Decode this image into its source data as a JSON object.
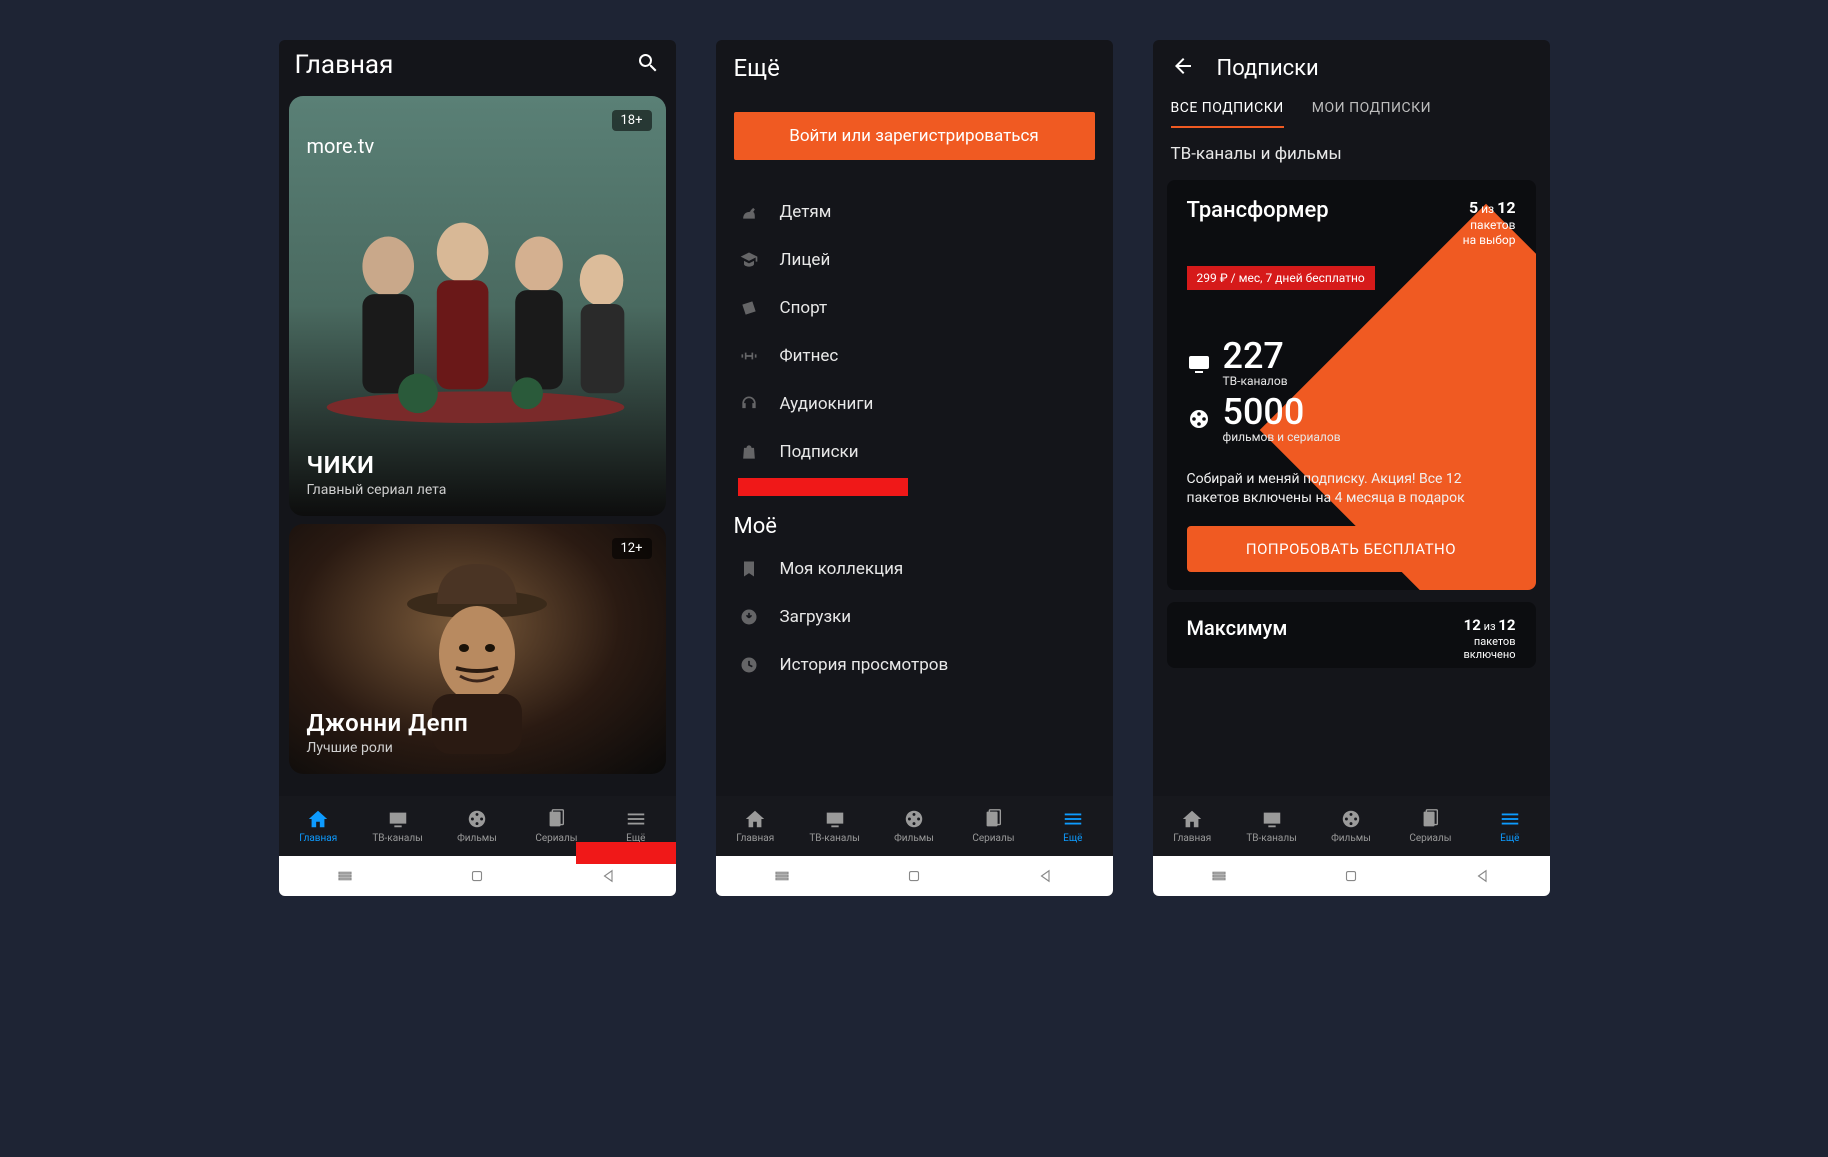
{
  "colors": {
    "accent": "#f05a22",
    "brand_blue": "#0d9bff",
    "danger": "#d61a1a"
  },
  "nav": [
    {
      "label": "Главная"
    },
    {
      "label": "ТВ-каналы"
    },
    {
      "label": "Фильмы"
    },
    {
      "label": "Сериалы"
    },
    {
      "label": "Ещё"
    }
  ],
  "screen1": {
    "title": "Главная",
    "card1": {
      "brand": "more.tv",
      "age": "18+",
      "title": "ЧИКИ",
      "subtitle": "Главный сериал лета"
    },
    "card2": {
      "age": "12+",
      "title": "Джонни Депп",
      "subtitle": "Лучшие роли"
    }
  },
  "screen2": {
    "title": "Ещё",
    "login": "Войти или зарегистрироваться",
    "menu": [
      {
        "label": "Детям"
      },
      {
        "label": "Лицей"
      },
      {
        "label": "Спорт"
      },
      {
        "label": "Фитнес"
      },
      {
        "label": "Аудиокниги"
      },
      {
        "label": "Подписки"
      }
    ],
    "mine_title": "Моё",
    "mine": [
      {
        "label": "Моя коллекция"
      },
      {
        "label": "Загрузки"
      },
      {
        "label": "История просмотров"
      }
    ]
  },
  "screen3": {
    "title": "Подписки",
    "tabs": [
      "ВСЕ ПОДПИСКИ",
      "МОИ ПОДПИСКИ"
    ],
    "section": "ТВ-каналы и фильмы",
    "plan1": {
      "name": "Трансформер",
      "count_a": "5",
      "count_sep": "из",
      "count_b": "12",
      "right_line1": "пакетов",
      "right_line2": "на выбор",
      "price": "299 ₽ / мес, 7 дней бесплатно",
      "stat1_num": "227",
      "stat1_label": "ТВ-каналов",
      "stat2_num": "5000",
      "stat2_label": "фильмов и сериалов",
      "desc": "Собирай и меняй подписку. Акция! Все 12 пакетов включены на 4 месяца в подарок",
      "cta": "ПОПРОБОВАТЬ БЕСПЛАТНО"
    },
    "plan2": {
      "name": "Максимум",
      "count_a": "12",
      "count_sep": "из",
      "count_b": "12",
      "right_line1": "пакетов",
      "right_line2": "включено"
    }
  }
}
